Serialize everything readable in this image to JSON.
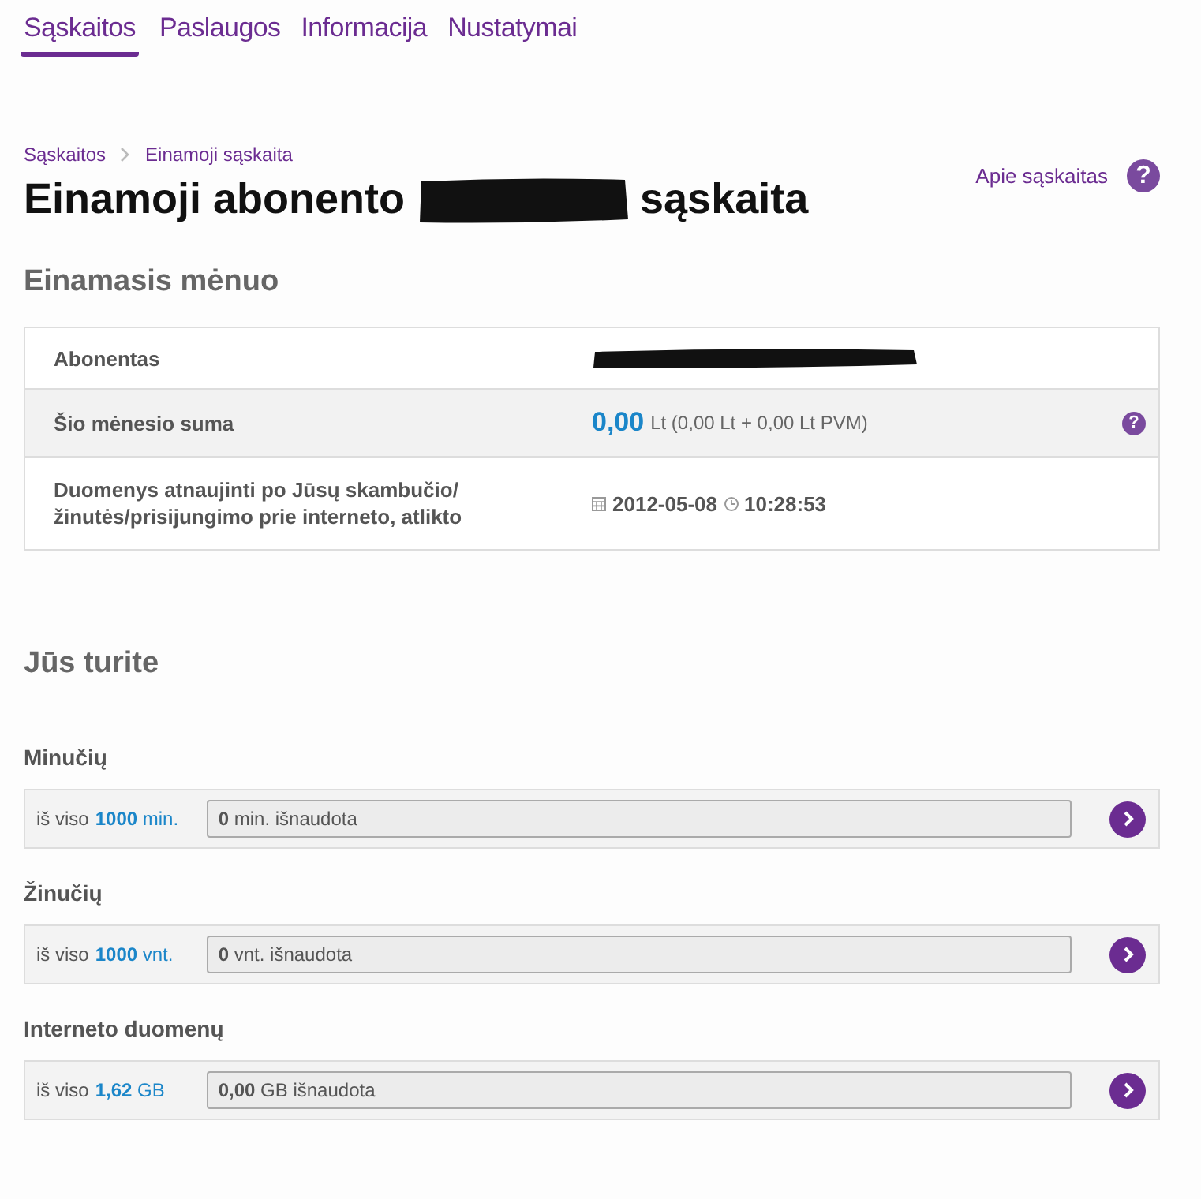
{
  "nav": [
    {
      "label": "Sąskaitos",
      "selected": true
    },
    {
      "label": "Paslaugos",
      "selected": false
    },
    {
      "label": "Informacija",
      "selected": false
    },
    {
      "label": "Nustatymai",
      "selected": false
    }
  ],
  "breadcrumb": [
    "Sąskaitos",
    "Einamoji sąskaita"
  ],
  "help_link": "Apie sąskaitas",
  "help_link_icon": "?",
  "title": {
    "before": "Einamoji abonento",
    "after": "sąskaita"
  },
  "current_month": {
    "heading": "Einamasis mėnuo",
    "rows": [
      {
        "kind": "redacted",
        "label": "Abonentas"
      },
      {
        "kind": "sum",
        "label": "Šio mėnesio suma",
        "amount": "0,00",
        "detail": "Lt (0,00 Lt + 0,00 Lt PVM)",
        "help_icon": "?"
      },
      {
        "kind": "datetime",
        "label": "Duomenys atnaujinti po Jūsų skambučio/žinutės/prisijungimo prie interneto, atlikto",
        "date": "2012-05-08",
        "time": "10:28:53"
      }
    ]
  },
  "balance": {
    "heading": "Jūs turite",
    "items": [
      {
        "heading": "Minučių",
        "prefix": "iš viso",
        "total": "**1000** min.",
        "used": "**0** min. išnaudota"
      },
      {
        "heading": "Žinučių",
        "prefix": "iš viso",
        "total": "**1000** vnt.",
        "used": "**0** vnt. išnaudota"
      },
      {
        "heading": "Interneto duomenų",
        "prefix": "iš viso",
        "total": "**1,62** GB",
        "used": "**0,00** GB išnaudota"
      }
    ]
  }
}
